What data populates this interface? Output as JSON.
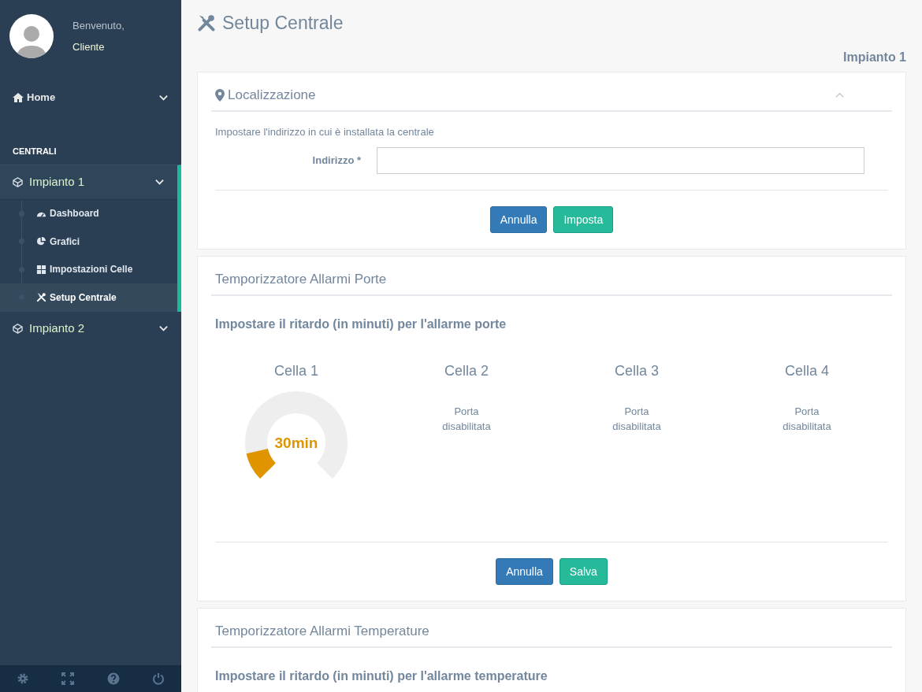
{
  "profile": {
    "greeting": "Benvenuto,",
    "name": "Cliente"
  },
  "sidebar": {
    "home": {
      "label": "Home"
    },
    "section_title": "CENTRALI",
    "items": [
      {
        "label": "Impianto 1",
        "expanded": true,
        "selected": true,
        "children": [
          {
            "label": "Dashboard",
            "selected": false
          },
          {
            "label": "Grafici",
            "selected": false
          },
          {
            "label": "Impostazioni Celle",
            "selected": false
          },
          {
            "label": "Setup Centrale",
            "selected": true
          }
        ]
      },
      {
        "label": "Impianto 2",
        "expanded": false,
        "selected": false
      }
    ]
  },
  "page": {
    "title": "Setup Centrale",
    "subtitle": "Impianto 1"
  },
  "location_panel": {
    "title": "Localizzazione",
    "expanded": true,
    "description": "Impostare l'indirizzo in cui è installata la centrale",
    "field_label": "Indirizzo *",
    "buttons": [
      "Annulla",
      "Imposta"
    ]
  },
  "door_panel": {
    "title": "Temporizzatore Allarmi Porte",
    "heading": "Impostare il ritardo (in minuti) per l'allarme porte",
    "cells": [
      {
        "name": "Cella 1",
        "kind": "gauge",
        "reading": "30min",
        "level": 0.12
      },
      {
        "name": "Cella 2",
        "kind": "disabled",
        "message": "Porta disabilitata"
      },
      {
        "name": "Cella 3",
        "kind": "disabled",
        "message": "Porta disabilitata"
      },
      {
        "name": "Cella 4",
        "kind": "disabled",
        "message": "Porta disabilitata"
      }
    ],
    "buttons": [
      "Annulla",
      "Salva"
    ]
  },
  "temperature_panel": {
    "title": "Temporizzatore Allarmi Temperature",
    "heading": "Impostare il ritardo (in minuti) per l'allarme temperature"
  }
}
